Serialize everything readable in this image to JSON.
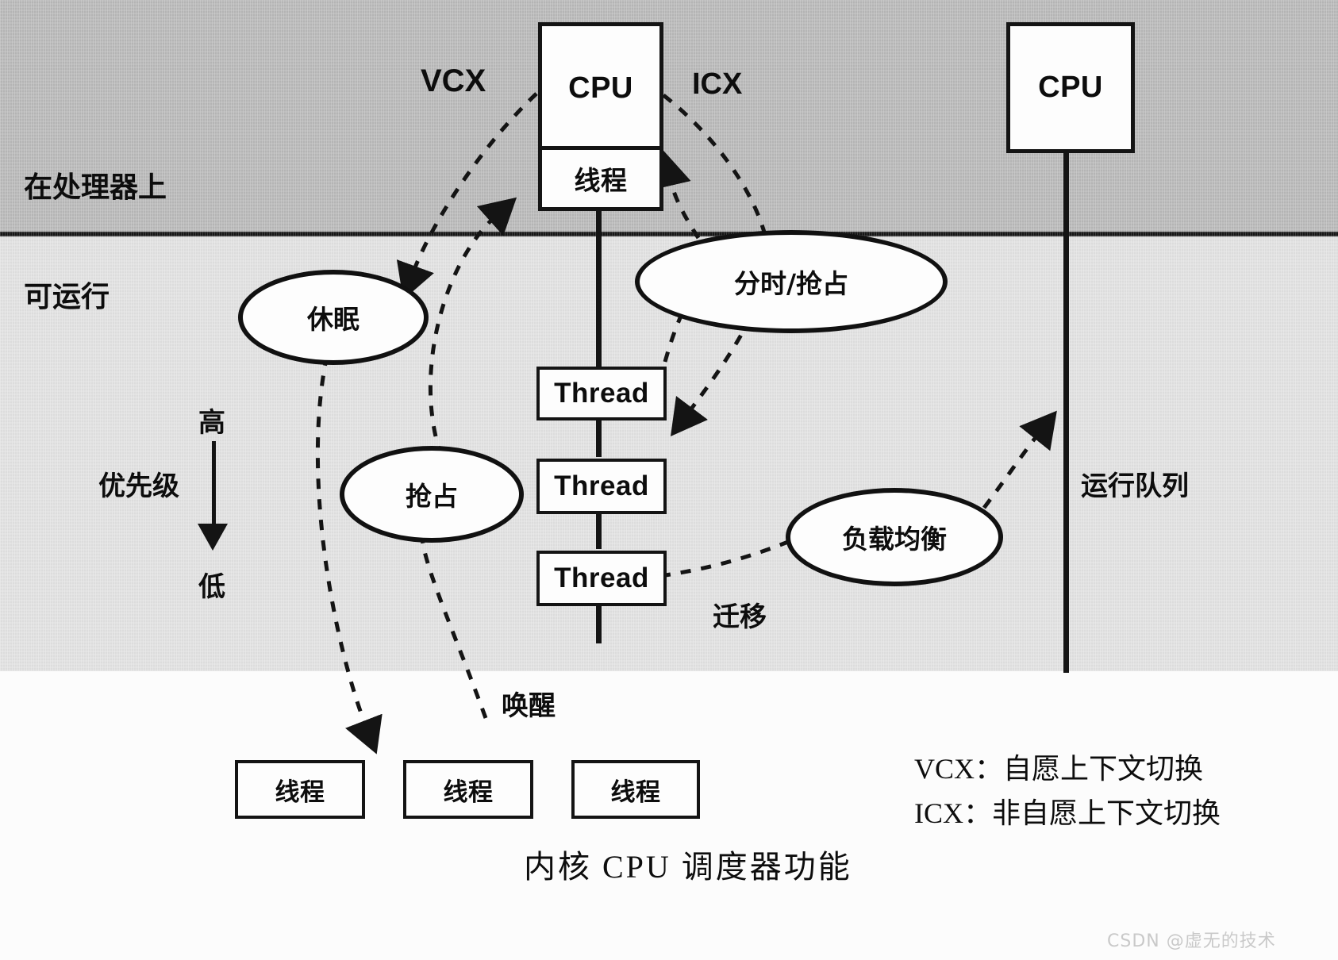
{
  "figure": {
    "caption": "内核 CPU 调度器功能",
    "watermark": "CSDN @虚无的技术"
  },
  "bands": [
    {
      "name": "on-processor",
      "label": "在处理器上",
      "color": "#b9b9b9"
    },
    {
      "name": "runnable",
      "label": "可运行",
      "color": "#e2e2e2"
    }
  ],
  "priority": {
    "top_label": "高",
    "axis_label": "优先级",
    "bottom_label": "低"
  },
  "cpus": [
    {
      "name": "cpu-left",
      "label": "CPU",
      "thread_label": "线程"
    },
    {
      "name": "cpu-right",
      "label": "CPU"
    }
  ],
  "transitions": {
    "vcx": "VCX",
    "icx": "ICX"
  },
  "runqueue_label": "运行队列",
  "migration_label": "迁移",
  "wakeup_label": "唤醒",
  "states": [
    {
      "name": "sleep",
      "label": "休眠"
    },
    {
      "name": "preempt",
      "label": "抢占"
    },
    {
      "name": "timeshare-preempt",
      "label": "分时/抢占"
    },
    {
      "name": "load-balance",
      "label": "负载均衡"
    }
  ],
  "runqueue_threads": [
    {
      "label": "Thread"
    },
    {
      "label": "Thread"
    },
    {
      "label": "Thread"
    }
  ],
  "sleeping_threads": [
    {
      "label": "线程"
    },
    {
      "label": "线程"
    },
    {
      "label": "线程"
    }
  ],
  "legend": [
    {
      "key": "VCX",
      "sep": "：",
      "text": "自愿上下文切换",
      "full": "VCX：自愿上下文切换"
    },
    {
      "key": "ICX",
      "sep": "：",
      "text": "非自愿上下文切换",
      "full": "ICX：非自愿上下文切换"
    }
  ]
}
